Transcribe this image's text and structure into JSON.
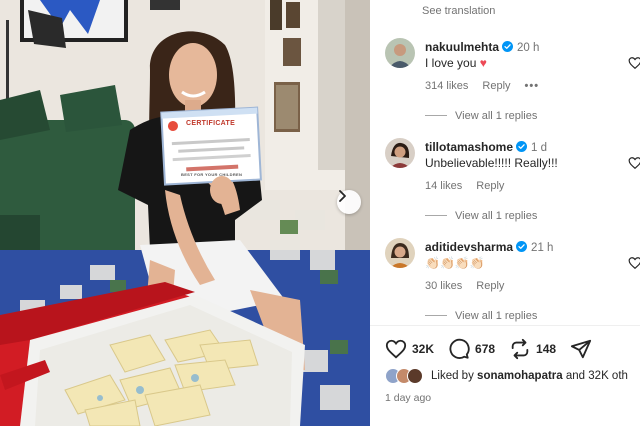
{
  "post": {
    "certificate": {
      "title_line": "CERTIFICATE",
      "recipient_line": "BEST FOR YOUR CHILDREN"
    }
  },
  "panel": {
    "see_translation": "See translation",
    "comments": [
      {
        "username": "nakuulmehta",
        "time": "20 h",
        "text": "I love you",
        "emoji": "♥",
        "likes": "314 likes",
        "reply": "Reply",
        "more": "•••",
        "view_replies": "View all 1 replies"
      },
      {
        "username": "tillotamashome",
        "time": "1 d",
        "text": "Unbelievable!!!!! Really!!!",
        "likes": "14 likes",
        "reply": "Reply",
        "view_replies": "View all 1 replies"
      },
      {
        "username": "aditidevsharma",
        "time": "21 h",
        "text": "👏🏻👏🏻👏🏻👏🏻",
        "likes": "30 likes",
        "reply": "Reply",
        "view_replies": "View all 1 replies"
      }
    ],
    "actions": {
      "likes_count": "32K",
      "comments_count": "678",
      "reposts_count": "148"
    },
    "liked_by": {
      "prefix": "Liked by",
      "user": "sonamohapatra",
      "suffix": "and 32K oth"
    },
    "posted_ago": "1 day ago"
  },
  "colors": {
    "verified_blue": "#0095f6",
    "heart_red": "#ed4956",
    "muted_text": "#737373",
    "primary_text": "#262626"
  },
  "icons": {
    "like": "heart-icon",
    "comment": "comment-icon",
    "repost": "repost-icon",
    "share": "send-icon",
    "next": "chevron-right-icon",
    "verified": "verified-badge-icon"
  }
}
